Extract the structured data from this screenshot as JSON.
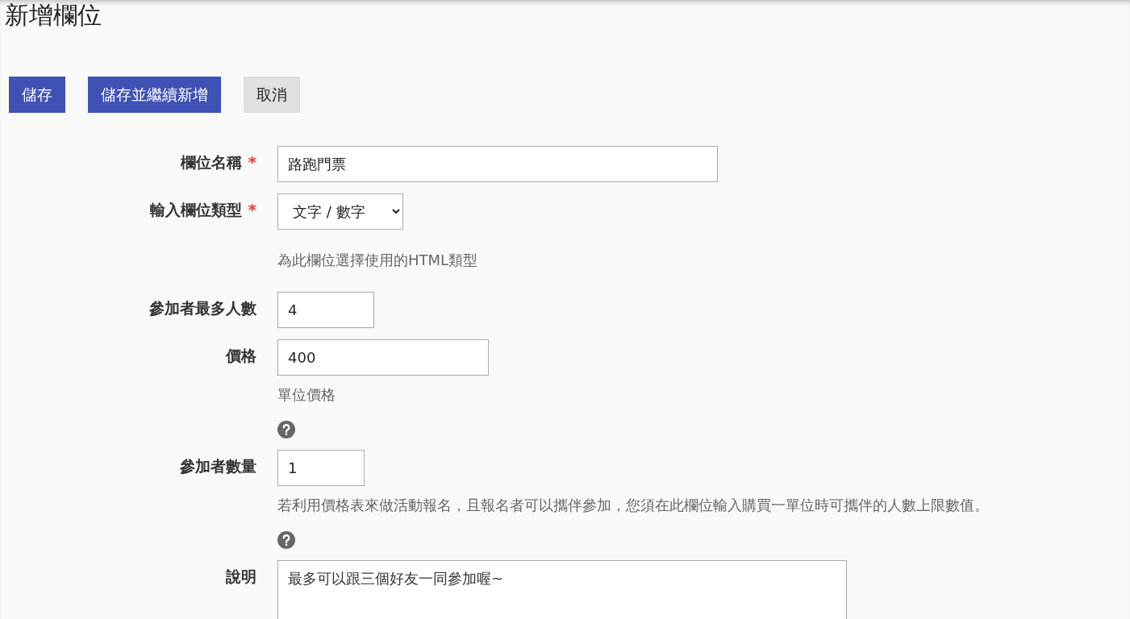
{
  "title": "新增欄位",
  "buttons": [
    {
      "label": "儲存",
      "kind": "primary"
    },
    {
      "label": "儲存並繼續新增",
      "kind": "primary"
    },
    {
      "label": "取消",
      "kind": "secondary"
    }
  ],
  "fields": [
    {
      "label": "欄位名稱",
      "required_mark": "*",
      "kind": "text",
      "value": "路跑門票"
    },
    {
      "label": "輸入欄位類型",
      "required_mark": "*",
      "kind": "select",
      "value": "文字 / 數字",
      "help": "為此欄位選擇使用的HTML類型"
    },
    {
      "label": "參加者最多人數",
      "kind": "text",
      "value": "4"
    },
    {
      "label": "價格",
      "kind": "text",
      "value": "400",
      "help": "單位價格",
      "help_icon": true
    },
    {
      "label": "參加者數量",
      "kind": "text",
      "value": "1",
      "help": "若利用價格表來做活動報名，且報名者可以攜伴參加，您須在此欄位輸入購買一單位時可攜伴的人數上限數值。",
      "help_icon": true
    },
    {
      "label": "說明",
      "kind": "textarea",
      "value": "最多可以跟三個好友一同參加喔~"
    }
  ]
}
